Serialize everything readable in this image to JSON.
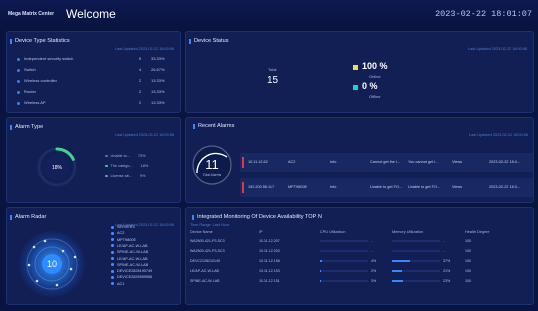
{
  "header": {
    "brand": "Mega Matrix Center",
    "title": "Welcome",
    "datetime": "2023-02-22 18:01:07"
  },
  "device_types": {
    "title": "Device Type Statistics",
    "updated": "Last Updated 2023-02-22 18:00:56",
    "items": [
      {
        "name": "Independent security switch",
        "count": "5",
        "pct": "33.33%"
      },
      {
        "name": "Switch",
        "count": "4",
        "pct": "26.67%"
      },
      {
        "name": "Wireless controller",
        "count": "2",
        "pct": "13.33%"
      },
      {
        "name": "Router",
        "count": "2",
        "pct": "13.33%"
      },
      {
        "name": "Wireless AP",
        "count": "2",
        "pct": "13.33%"
      }
    ]
  },
  "device_status": {
    "title": "Device Status",
    "updated": "Last Updated 2023-02-22 18:00:56",
    "total_label": "Total",
    "total": "15",
    "online_pct": "100 %",
    "online_label": "Online",
    "offline_pct": "0 %",
    "offline_label": "Offline",
    "online_color": "#f2d94e",
    "offline_color": "#19d3c5"
  },
  "alarm_type": {
    "title": "Alarm Type",
    "updated": "Last Updated 2023-02-22 18:00:56",
    "center_pct": "18%",
    "ring_fraction": 0.18,
    "items": [
      {
        "label": "Unable to...",
        "pct": "73%",
        "color": "#3f7ce0"
      },
      {
        "label": "The catego...",
        "pct": "18%",
        "color": "#3fd58a"
      },
      {
        "label": "License ab...",
        "pct": "9%",
        "color": "#8a8fa8"
      }
    ]
  },
  "recent_alarms": {
    "title": "Recent Alarms",
    "updated": "Last Updated 2023-02-22 18:00:56",
    "total": "11",
    "total_label": "Total Alarms",
    "rows": [
      {
        "time": "10.11.12.62",
        "device": "AC2",
        "level": "Info",
        "msg1": "Cannot get the l...",
        "msg2": "You cannot get l...",
        "action": "Views",
        "date": "2023-02-22 18:4..."
      },
      {
        "time": "192.200.56.117",
        "device": "MPT9800E",
        "level": "Info",
        "msg1": "Unable to get FO...",
        "msg2": "Unable to get FO...",
        "action": "Views",
        "date": "2023-02-22 18:3..."
      }
    ]
  },
  "alarm_radar": {
    "title": "Alarm Radar",
    "updated": "Last Updated 2023-02-22 18:00:56",
    "center": "10",
    "devices": [
      "SERVER3",
      "AC2",
      "MPT9800E",
      "LE/AP-AC-W-LAB",
      "SPINE-AC-W-LAB",
      "LE/AP-AC-W-LAB",
      "SPINE-AC-W-LAB",
      "DEVICE2828190749",
      "DEVICE2828959556",
      "AC1"
    ]
  },
  "monitoring": {
    "title": "Integrated Monitoring Of Device Availability TOP N",
    "subtitle": "Time Range: Last Hour",
    "headers": [
      "Device Name",
      "IP",
      "CPU Utilization",
      "Memory Utilization",
      "Health Degree"
    ],
    "rows": [
      {
        "name": "WA2600-421-FS,SC3",
        "ip": "10.11.12.207",
        "cpu": "-",
        "cpu_fill": 0,
        "mem": "-",
        "mem_fill": 0,
        "health": "100"
      },
      {
        "name": "WA2600-421-FS,SC3",
        "ip": "10.11.12.203",
        "cpu": "-",
        "cpu_fill": 0,
        "mem": "-",
        "mem_fill": 0,
        "health": "100"
      },
      {
        "name": "DEVC2128210149",
        "ip": "10.11.12.158",
        "cpu": "4%",
        "cpu_fill": 0.04,
        "mem": "37%",
        "mem_fill": 0.37,
        "health": "100"
      },
      {
        "name": "LE/AP-AC-W-LAB",
        "ip": "10.11.12.153",
        "cpu": "2%",
        "cpu_fill": 0.02,
        "mem": "21%",
        "mem_fill": 0.21,
        "health": "100"
      },
      {
        "name": "SPINE-AC-W-LAB",
        "ip": "10.11.12.151",
        "cpu": "3%",
        "cpu_fill": 0.03,
        "mem": "23%",
        "mem_fill": 0.23,
        "health": "100"
      }
    ]
  }
}
